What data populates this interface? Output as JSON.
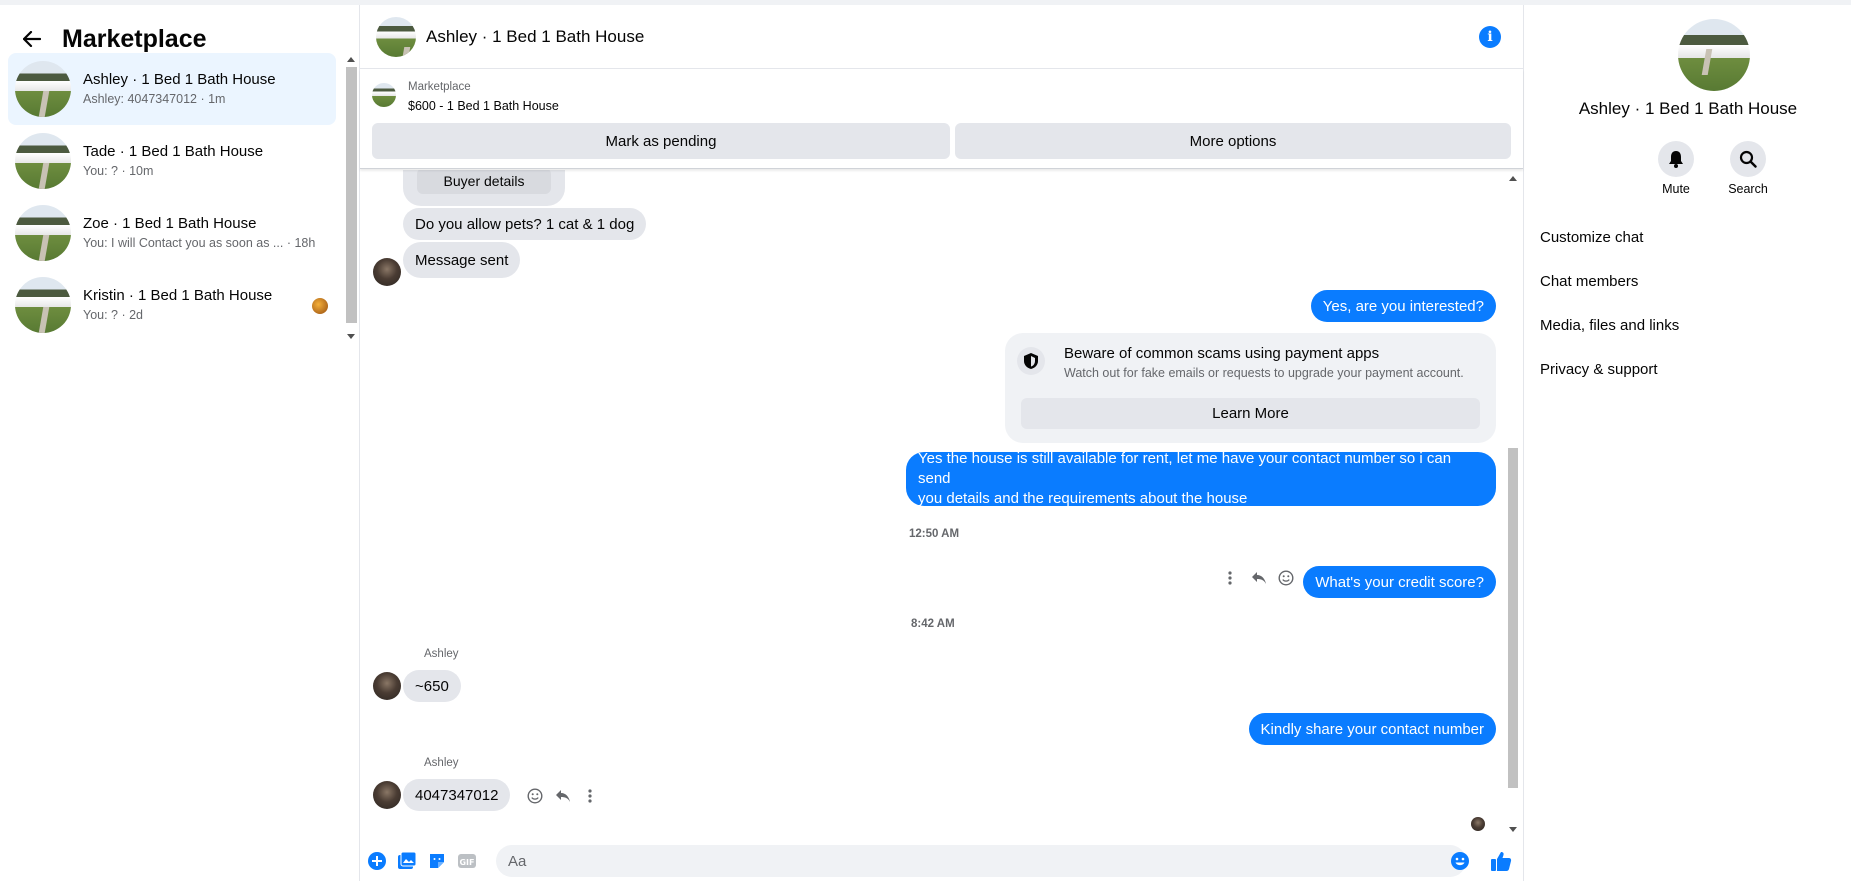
{
  "sidebar": {
    "title": "Marketplace",
    "conversations": [
      {
        "name": "Ashley · 1 Bed 1 Bath House",
        "preview": "Ashley: 4047347012 · 1m"
      },
      {
        "name": "Tade · 1 Bed 1 Bath House",
        "preview": "You: ? · 10m"
      },
      {
        "name": "Zoe · 1 Bed 1 Bath House",
        "preview": "You: I will Contact you as soon as ... · 18h"
      },
      {
        "name": "Kristin · 1 Bed 1 Bath House",
        "preview": "You: ? · 2d"
      }
    ]
  },
  "chat": {
    "title": "Ashley · 1 Bed 1 Bath House",
    "listing": {
      "kicker": "Marketplace",
      "price_title": "$600 - 1 Bed 1 Bath House",
      "pending_label": "Mark as pending",
      "more_label": "More options"
    },
    "messages": {
      "buyer_details": "Buyer details",
      "pets": "Do you allow pets? 1 cat & 1 dog",
      "sent": "Message sent",
      "interested": "Yes, are you interested?",
      "scam_title": "Beware of common scams using payment apps",
      "scam_sub": "Watch out for fake emails or requests to upgrade your payment account.",
      "learn_more": "Learn More",
      "available_line1": "Yes the house is still available for rent, let me have your contact number so i can send",
      "available_line2": "you details and the requirements about the house",
      "time1": "12:50 AM",
      "credit": "What's your credit score?",
      "time2": "8:42 AM",
      "sender1": "Ashley",
      "score": "~650",
      "share": "Kindly share your contact number",
      "sender2": "Ashley",
      "phone": "4047347012"
    },
    "composer": {
      "placeholder": "Aa"
    }
  },
  "details": {
    "title": "Ashley · 1 Bed 1 Bath House",
    "mute_label": "Mute",
    "search_label": "Search",
    "menu": [
      "Customize chat",
      "Chat members",
      "Media, files and links",
      "Privacy & support"
    ]
  },
  "colors": {
    "accent": "#0a7cff",
    "bubble_in": "#e4e6eb",
    "active_row": "#ebf5ff"
  }
}
